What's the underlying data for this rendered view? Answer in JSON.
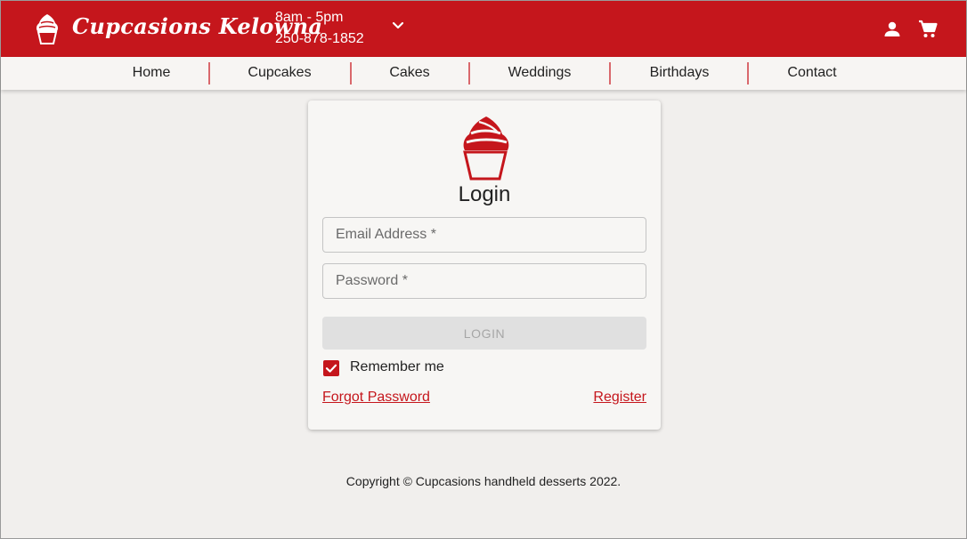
{
  "header": {
    "brand_name": "Cupcasions Kelowna",
    "hours": "8am - 5pm",
    "phone": "250-878-1852",
    "icons": [
      "cupcake-icon",
      "chevron-down-icon",
      "account-icon",
      "cart-icon"
    ]
  },
  "nav": {
    "items": [
      {
        "label": "Home"
      },
      {
        "label": "Cupcakes"
      },
      {
        "label": "Cakes"
      },
      {
        "label": "Weddings"
      },
      {
        "label": "Birthdays"
      },
      {
        "label": "Contact"
      }
    ]
  },
  "login": {
    "title": "Login",
    "email_placeholder": "Email Address *",
    "email_value": "",
    "password_placeholder": "Password *",
    "password_value": "",
    "login_button": "LOGIN",
    "remember_label": "Remember me",
    "remember_checked": true,
    "forgot_label": "Forgot Password",
    "register_label": "Register"
  },
  "footer": {
    "copyright": "Copyright © Cupcasions handheld desserts 2022."
  },
  "colors": {
    "brand_red": "#c5161c",
    "nav_background": "#f7f5f3",
    "page_background": "#f1efed",
    "separator": "#d9686c"
  }
}
